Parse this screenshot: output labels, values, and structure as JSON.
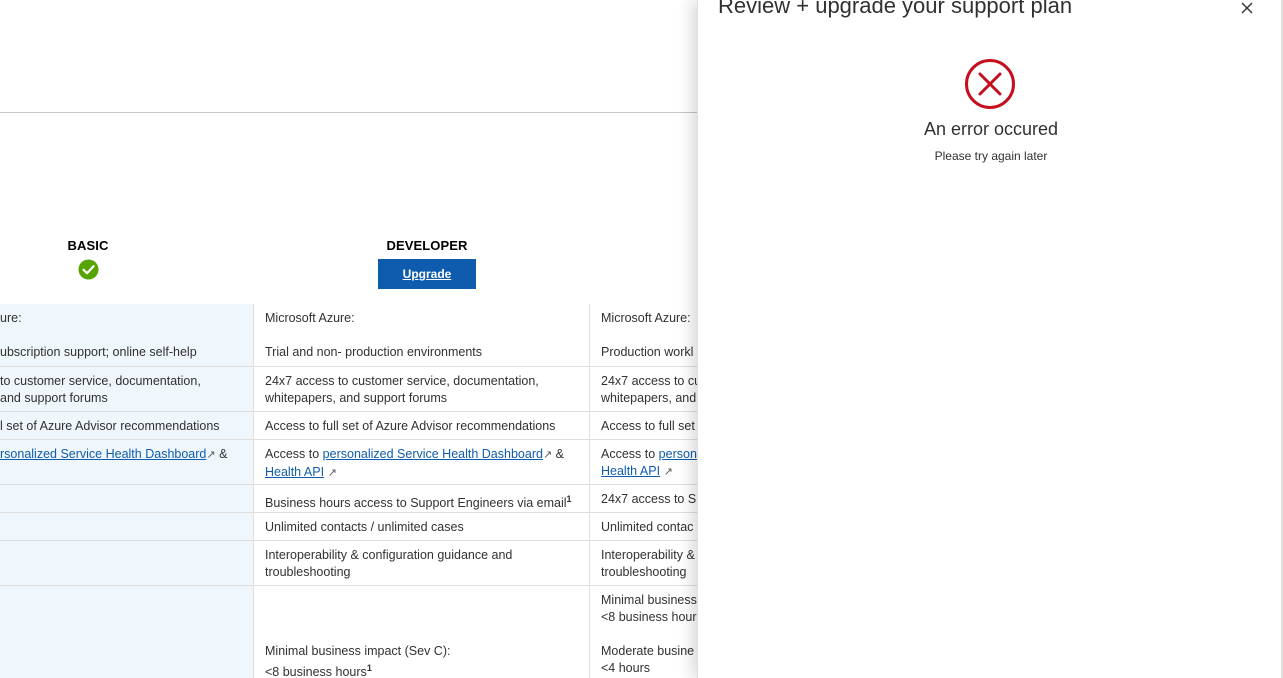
{
  "plans": {
    "basic": {
      "name": "BASIC"
    },
    "developer": {
      "name": "DEVELOPER",
      "upgrade_label": "Upgrade"
    }
  },
  "rows": [
    {
      "basic": [
        "ure:",
        "ubscription support; online self-help"
      ],
      "developer": [
        "Microsoft Azure:",
        "Trial and non- production environments"
      ],
      "standard": [
        "Microsoft Azure:",
        "Production workl"
      ]
    },
    {
      "basic": [
        "to customer service, documentation,",
        " and support forums"
      ],
      "developer": [
        "24x7 access to customer service, documentation,",
        "whitepapers, and support forums"
      ],
      "standard": [
        "24x7 access to cu",
        "whitepapers, and"
      ]
    },
    {
      "basic": [
        "l set of Azure Advisor recommendations"
      ],
      "developer": [
        "Access to full set of Azure Advisor recommendations"
      ],
      "standard": [
        "Access to full set"
      ]
    },
    {
      "basic_link": "rsonalized Service Health Dashboard",
      "basic_after": " &",
      "developer_prefix": "Access to ",
      "developer_link1": "personalized Service Health Dashboard",
      "developer_amp": " &",
      "developer_link2": "Health API",
      "standard_prefix": "Access to ",
      "standard_link1": "person",
      "standard_link2": "Health API"
    },
    {
      "developer": "Business hours access to Support Engineers via email",
      "developer_sup": "1",
      "standard": "24x7 access to Su"
    },
    {
      "developer": "Unlimited contacts / unlimited cases",
      "standard": "Unlimited contac"
    },
    {
      "developer": [
        "Interoperability & configuration guidance and",
        "troubleshooting"
      ],
      "standard": [
        "Interoperability &",
        "troubleshooting"
      ]
    },
    {
      "developer": [
        "Minimal business impact (Sev C):",
        "<8 business hours"
      ],
      "developer_sup": "1",
      "standard": [
        "Minimal business",
        "<8 business hour",
        "Moderate busine",
        "<4 hours"
      ]
    }
  ],
  "panel": {
    "title": "Review + upgrade your support plan",
    "error_title": "An error occured",
    "error_sub": "Please try again later"
  },
  "colors": {
    "accent": "#0f5cae",
    "error": "#c50f1f",
    "success": "#57a300",
    "basic_column_bg": "#eff6fc"
  }
}
